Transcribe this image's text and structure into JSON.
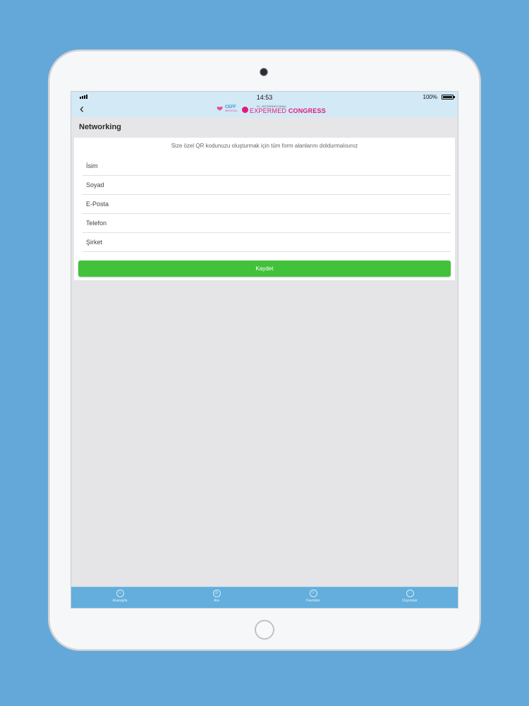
{
  "status_bar": {
    "time": "14:53",
    "battery": "100%"
  },
  "nav": {
    "back_glyph": "‹",
    "logo_one": {
      "line1": "CEFF",
      "line2": "MEDICAL"
    },
    "logo_two": {
      "small": "III. INTERNATIONAL",
      "part1": "EXPERMED",
      "part2": "CONGRESS"
    }
  },
  "page": {
    "title": "Networking"
  },
  "form": {
    "instruction": "Size özel QR kodunuzu oluşturmak için tüm form alanlarını doldurmalısınız",
    "fields": [
      {
        "placeholder": "İsim",
        "value": ""
      },
      {
        "placeholder": "Soyad",
        "value": ""
      },
      {
        "placeholder": "E-Posta",
        "value": ""
      },
      {
        "placeholder": "Telefon",
        "value": ""
      },
      {
        "placeholder": "Şirket",
        "value": ""
      }
    ],
    "submit_label": "Kaydet"
  },
  "tabs": [
    {
      "label": "Anasayfa",
      "icon": "home-icon",
      "glyph": "⌂"
    },
    {
      "label": "Ara",
      "icon": "search-icon",
      "glyph": "◎"
    },
    {
      "label": "Favoriler",
      "icon": "star-icon",
      "glyph": "☆"
    },
    {
      "label": "Duyurular",
      "icon": "bell-icon",
      "glyph": "◌"
    }
  ],
  "colors": {
    "background": "#64a8da",
    "header": "#d4e9f6",
    "submit": "#42c13a",
    "tab_bar": "#63aedc",
    "brand_pink": "#e01a7f"
  }
}
